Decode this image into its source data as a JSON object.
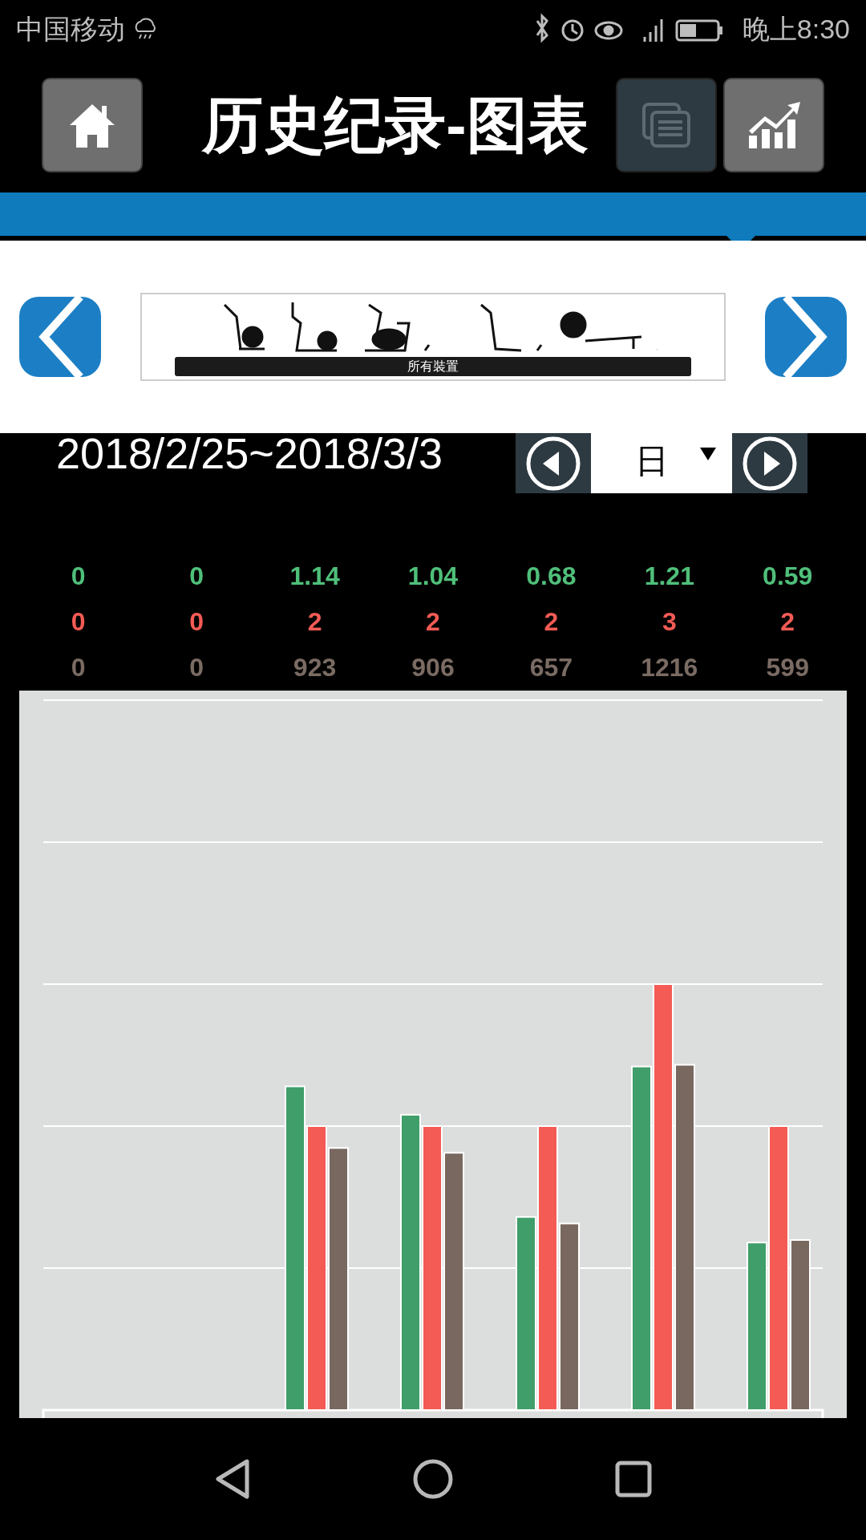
{
  "status_bar": {
    "carrier": "中国移动",
    "time": "晚上8:30"
  },
  "header": {
    "title": "历史纪录-图表",
    "view_buttons": [
      {
        "kind": "list"
      },
      {
        "kind": "chart"
      }
    ]
  },
  "device_filter": {
    "label": "所有裝置"
  },
  "period": {
    "range": "2018/2/25~2018/3/3",
    "unit": "日"
  },
  "stats_rows": [
    {
      "color": "#4fbf7a",
      "values": [
        "0",
        "0",
        "1.14",
        "1.04",
        "0.68",
        "1.21",
        "0.59"
      ]
    },
    {
      "color": "#f45b55",
      "values": [
        "0",
        "0",
        "2",
        "2",
        "2",
        "3",
        "2"
      ]
    },
    {
      "color": "#7a6b63",
      "values": [
        "0",
        "0",
        "923",
        "906",
        "657",
        "1216",
        "599"
      ]
    }
  ]
}
